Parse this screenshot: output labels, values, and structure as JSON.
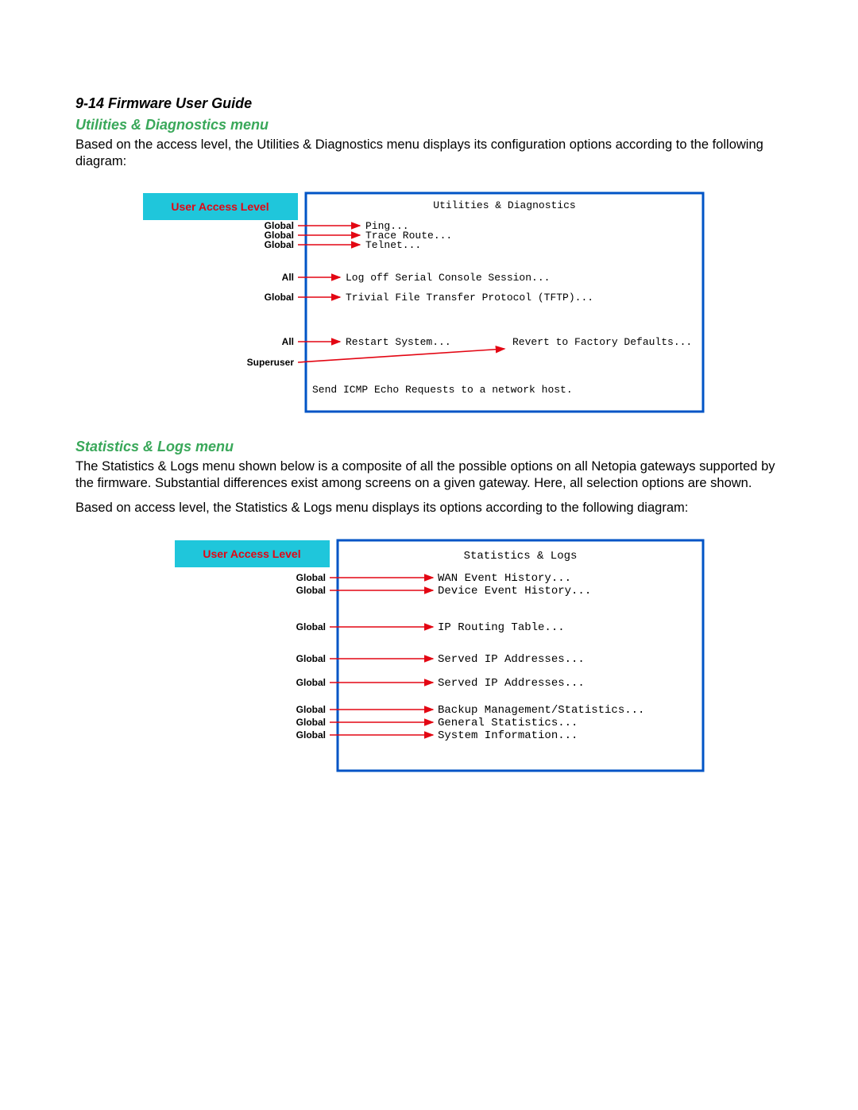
{
  "header": {
    "page_num_title": "9-14  Firmware User Guide"
  },
  "section1": {
    "title": "Utilities & Diagnostics menu",
    "intro": "Based on the access level, the Utilities & Diagnostics menu displays its configuration options according to the following diagram:"
  },
  "diagram1": {
    "access_box_title": "User Access Level",
    "screen_title": "Utilities & Diagnostics",
    "items": [
      {
        "access": "Global",
        "label": "Ping..."
      },
      {
        "access": "Global",
        "label": "Trace Route..."
      },
      {
        "access": "Global",
        "label": "Telnet..."
      },
      {
        "access": "All",
        "label": "Log off Serial Console Session..."
      },
      {
        "access": "Global",
        "label": "Trivial File Transfer Protocol (TFTP)..."
      },
      {
        "access": "All",
        "label": "Restart System..."
      },
      {
        "access": "Superuser",
        "label": "Revert to Factory Defaults..."
      }
    ],
    "footer_hint": "Send ICMP Echo Requests to a network host."
  },
  "section2": {
    "title": "Statistics & Logs menu",
    "intro": "The Statistics & Logs menu shown below is a composite of all the possible options on all Netopia gateways supported by the firmware. Substantial differences exist among screens on a given gateway. Here, all selection options are shown.",
    "intro2": "Based on access level, the Statistics & Logs menu displays its options according to the following diagram:"
  },
  "diagram2": {
    "access_box_title": "User Access Level",
    "screen_title": "Statistics & Logs",
    "items": [
      {
        "access": "Global",
        "label": "WAN Event History..."
      },
      {
        "access": "Global",
        "label": "Device Event History..."
      },
      {
        "access": "Global",
        "label": "IP Routing Table..."
      },
      {
        "access": "Global",
        "label": "Served IP Addresses..."
      },
      {
        "access": "Global",
        "label": "Served IP Addresses..."
      },
      {
        "access": "Global",
        "label": "Backup Management/Statistics..."
      },
      {
        "access": "Global",
        "label": "General Statistics..."
      },
      {
        "access": "Global",
        "label": "System Information..."
      }
    ]
  },
  "colors": {
    "green": "#3aa85a",
    "cyan": "#1fc6db",
    "red": "#e30613",
    "blue": "#0054c6"
  }
}
